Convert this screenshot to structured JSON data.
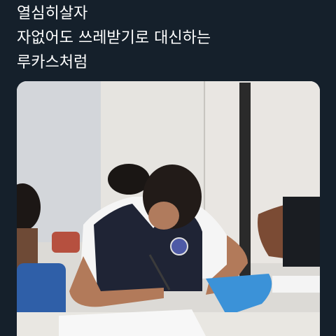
{
  "tweet": {
    "lines": [
      "열심히살자",
      "자없어도 쓰레받기로 대신하는",
      "루카스처럼"
    ]
  },
  "colors": {
    "background": "#15202b",
    "text": "#ffffff"
  }
}
